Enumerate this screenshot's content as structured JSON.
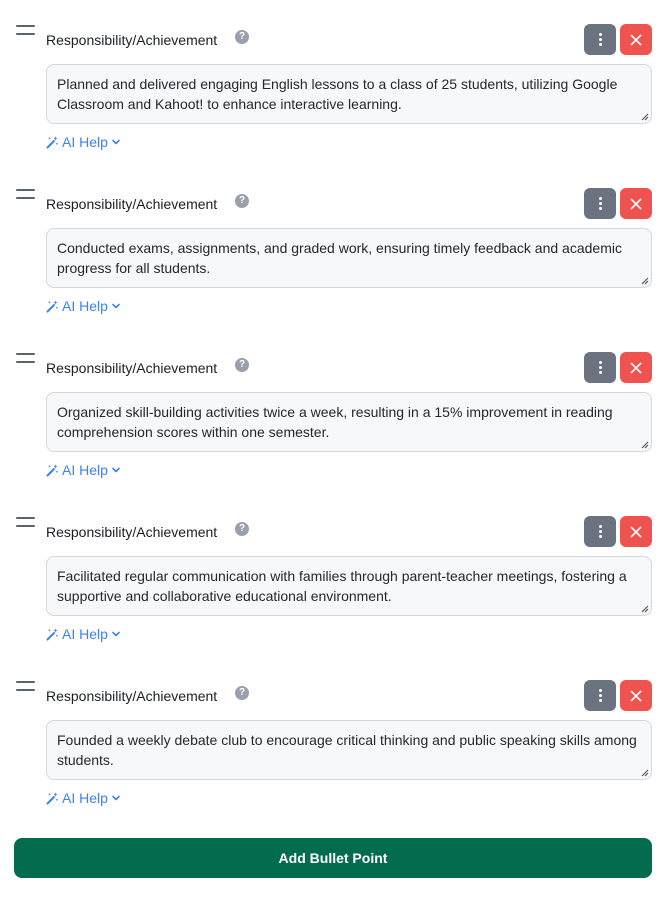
{
  "item_label": "Responsibility/Achievement",
  "help_glyph": "?",
  "ai_help_label": "AI Help",
  "items": [
    {
      "text": "Planned and delivered engaging English lessons to a class of 25 students, utilizing Google Classroom and Kahoot! to enhance interactive learning."
    },
    {
      "text": "Conducted exams, assignments, and graded work, ensuring timely feedback and academic progress for all students."
    },
    {
      "text": "Organized skill-building activities twice a week, resulting in a 15% improvement in reading comprehension scores within one semester."
    },
    {
      "text": "Facilitated regular communication with families through parent-teacher meetings, fostering a supportive and collaborative educational environment."
    },
    {
      "text": "Founded a weekly debate club to encourage critical thinking and public speaking skills among students."
    }
  ],
  "add_button_label": "Add Bullet Point",
  "colors": {
    "accent_blue": "#3b82f6",
    "delete_red": "#ef5350",
    "menu_gray": "#6b7280",
    "primary_green": "#046c4e"
  },
  "icons": {
    "drag": "drag-handle-icon",
    "help": "question-icon",
    "more": "more-vertical-icon",
    "delete": "close-icon",
    "magic": "magic-wand-icon",
    "chevron": "chevron-down-icon"
  }
}
